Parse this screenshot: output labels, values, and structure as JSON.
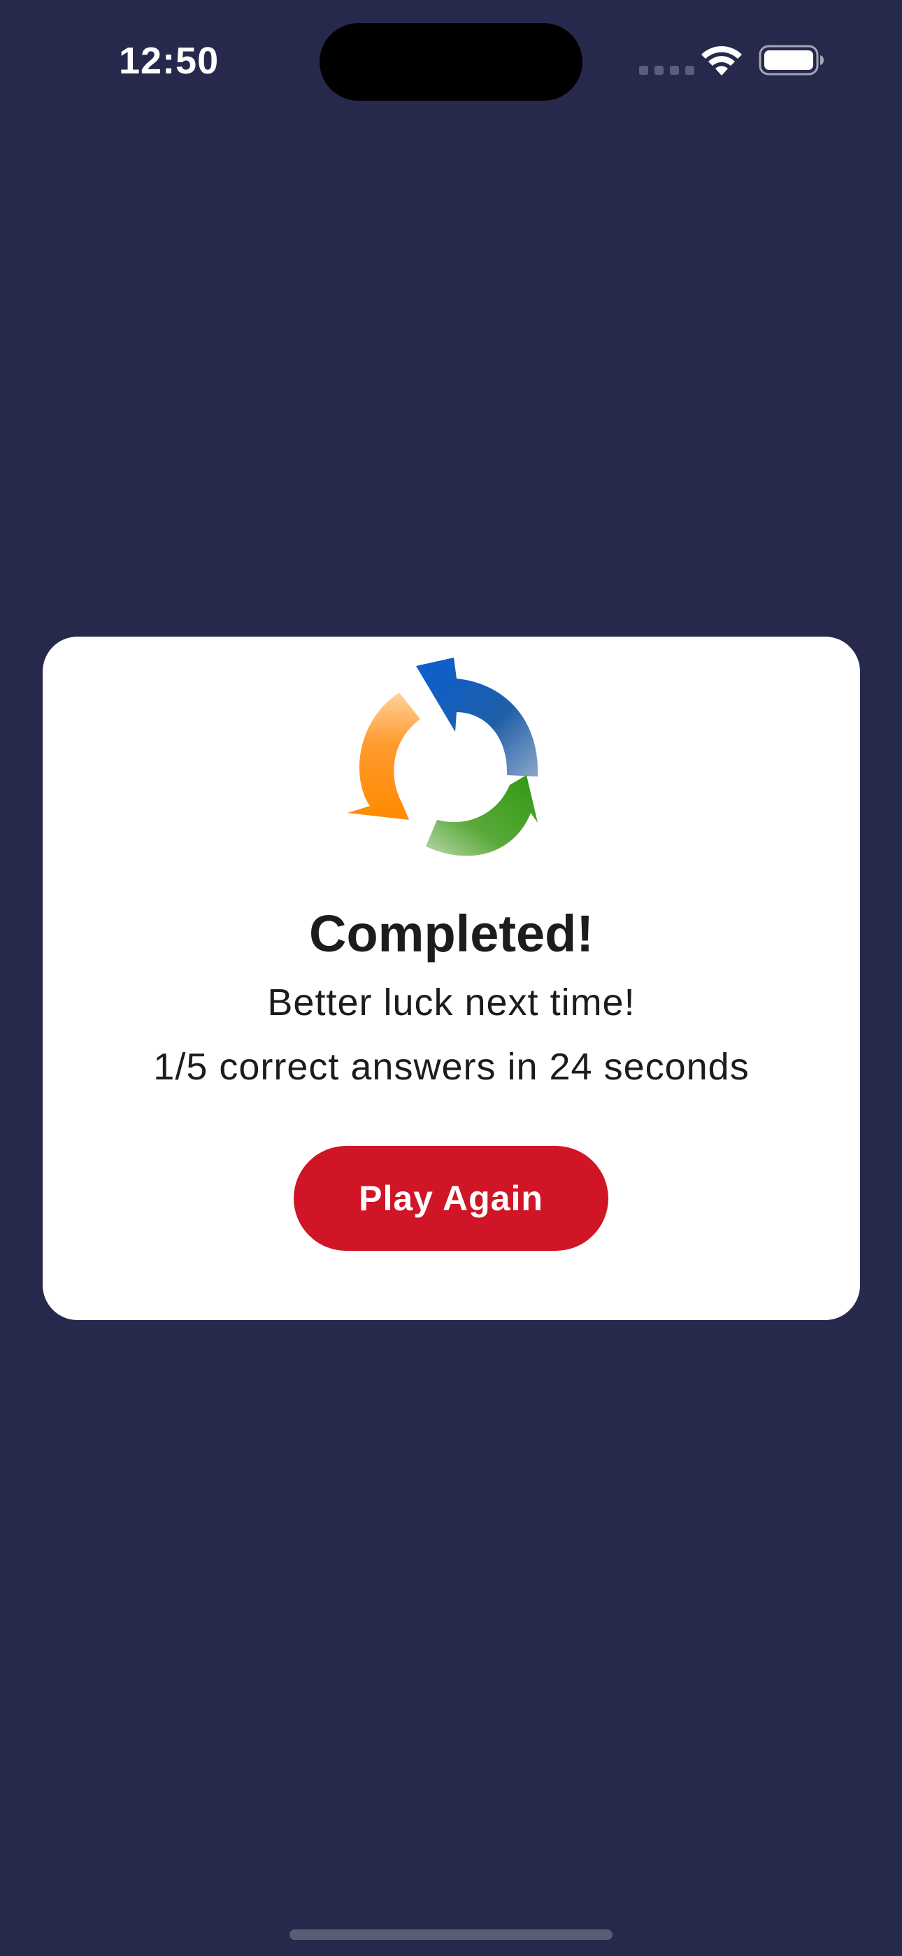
{
  "status_bar": {
    "time": "12:50",
    "icons": [
      "cellular-signal-icon",
      "wifi-icon",
      "battery-icon"
    ]
  },
  "result": {
    "icon": "refresh-cycle-icon",
    "title": "Completed!",
    "message": "Better luck next time!",
    "score_text": "1/5 correct answers in 24 seconds",
    "play_again_label": "Play Again"
  },
  "colors": {
    "background": "#27294c",
    "card": "#ffffff",
    "button": "#d01526",
    "arrow_blue": "#1763c8",
    "arrow_green": "#3f9e1e",
    "arrow_orange": "#ff8f14"
  }
}
